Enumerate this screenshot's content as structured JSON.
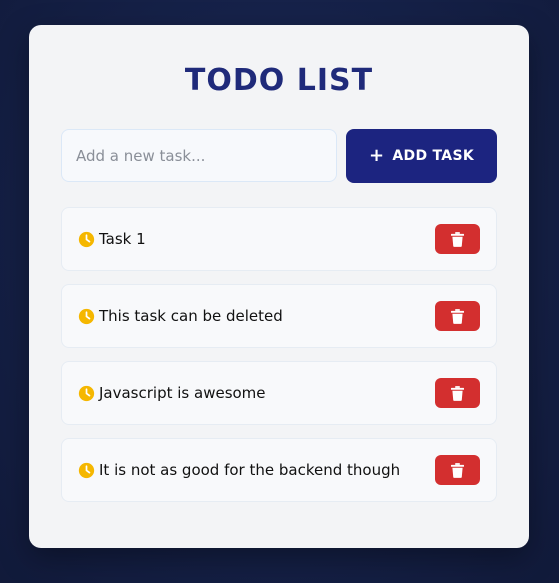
{
  "app": {
    "title": "TODO LIST"
  },
  "input": {
    "placeholder": "Add a new task...",
    "value": ""
  },
  "add_button": {
    "icon": "plus-icon",
    "label": "ADD TASK"
  },
  "tasks": [
    {
      "text": "Task 1",
      "status_icon": "clock-icon",
      "action_icon": "trash-icon"
    },
    {
      "text": "This task can be deleted",
      "status_icon": "clock-icon",
      "action_icon": "trash-icon"
    },
    {
      "text": "Javascript is awesome",
      "status_icon": "clock-icon",
      "action_icon": "trash-icon"
    },
    {
      "text": "It is not as good for the backend though",
      "status_icon": "clock-icon",
      "action_icon": "trash-icon"
    }
  ],
  "colors": {
    "title": "#1f2a7a",
    "add_button_bg": "#1c2480",
    "delete_button_bg": "#d32f2f",
    "clock_icon": "#f5b700",
    "background": "#16224a",
    "card": "#f3f4f6"
  }
}
